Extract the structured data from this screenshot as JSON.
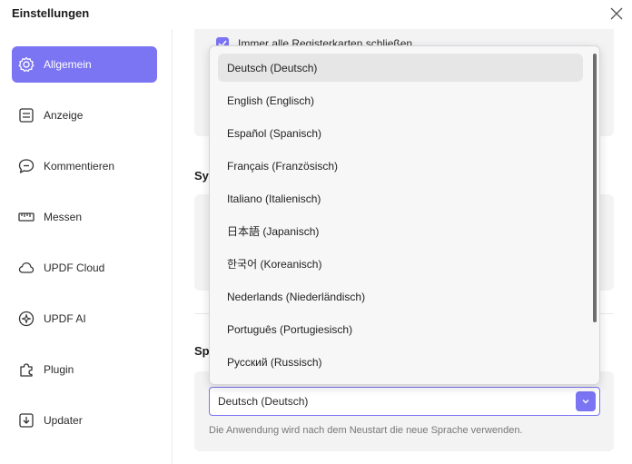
{
  "window": {
    "title": "Einstellungen",
    "close_icon": "close-icon"
  },
  "sidebar": {
    "items": [
      {
        "label": "Allgemein",
        "icon": "gear-icon",
        "active": true
      },
      {
        "label": "Anzeige",
        "icon": "display-icon",
        "active": false
      },
      {
        "label": "Kommentieren",
        "icon": "comment-icon",
        "active": false
      },
      {
        "label": "Messen",
        "icon": "ruler-icon",
        "active": false
      },
      {
        "label": "UPDF Cloud",
        "icon": "cloud-icon",
        "active": false
      },
      {
        "label": "UPDF AI",
        "icon": "ai-icon",
        "active": false
      },
      {
        "label": "Plugin",
        "icon": "plugin-icon",
        "active": false
      },
      {
        "label": "Updater",
        "icon": "updater-icon",
        "active": false
      }
    ]
  },
  "main": {
    "top_checkbox_label": "Immer alle Registerkarten schließen",
    "system_section_title": "System",
    "language_section_title": "Sprache"
  },
  "language": {
    "selected": "Deutsch (Deutsch)",
    "hint": "Die Anwendung wird nach dem Neustart die neue Sprache verwenden.",
    "options": [
      "Deutsch (Deutsch)",
      "English (Englisch)",
      "Español (Spanisch)",
      "Français (Französisch)",
      "Italiano (Italienisch)",
      "日本語 (Japanisch)",
      "한국어 (Koreanisch)",
      "Nederlands (Niederländisch)",
      "Português (Portugiesisch)",
      "Русский (Russisch)"
    ]
  },
  "colors": {
    "accent": "#7b74f3",
    "sidebar_active_text": "#ffffff",
    "card_bg": "#f3f3f4"
  }
}
